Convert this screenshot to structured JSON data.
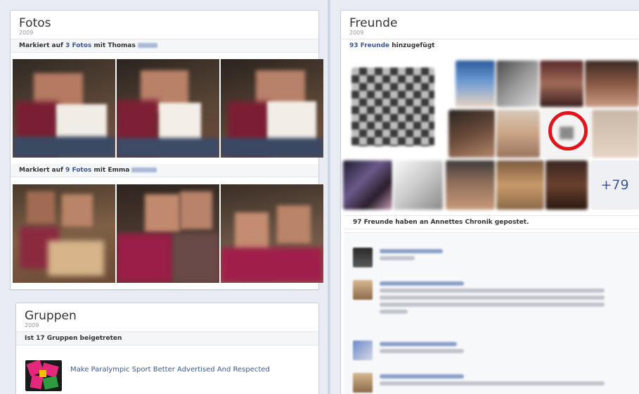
{
  "photos": {
    "title": "Fotos",
    "year": "2009",
    "row1": {
      "prefix": "Markiert auf ",
      "link": "3 Fotos",
      "mid": " mit ",
      "person": "Thomas"
    },
    "row2": {
      "prefix": "Markiert auf ",
      "link": "9 Fotos",
      "mid": " mit ",
      "person": "Emma"
    }
  },
  "friends": {
    "title": "Freunde",
    "year": "2009",
    "added_link": "93 Freunde",
    "added_text": " hinzugefügt",
    "more_count": "+79",
    "posted_text": "97 Freunde haben an Annettes Chronik gepostet."
  },
  "groups": {
    "title": "Gruppen",
    "year": "2009",
    "joined_text": "Ist 17 Gruppen beigetreten",
    "item_name": "Make Paralympic Sport Better Advertised And Respected"
  },
  "colors": {
    "link": "#3b5998",
    "highlight_circle": "#e3131b",
    "timeline": "#cdd6e5"
  }
}
